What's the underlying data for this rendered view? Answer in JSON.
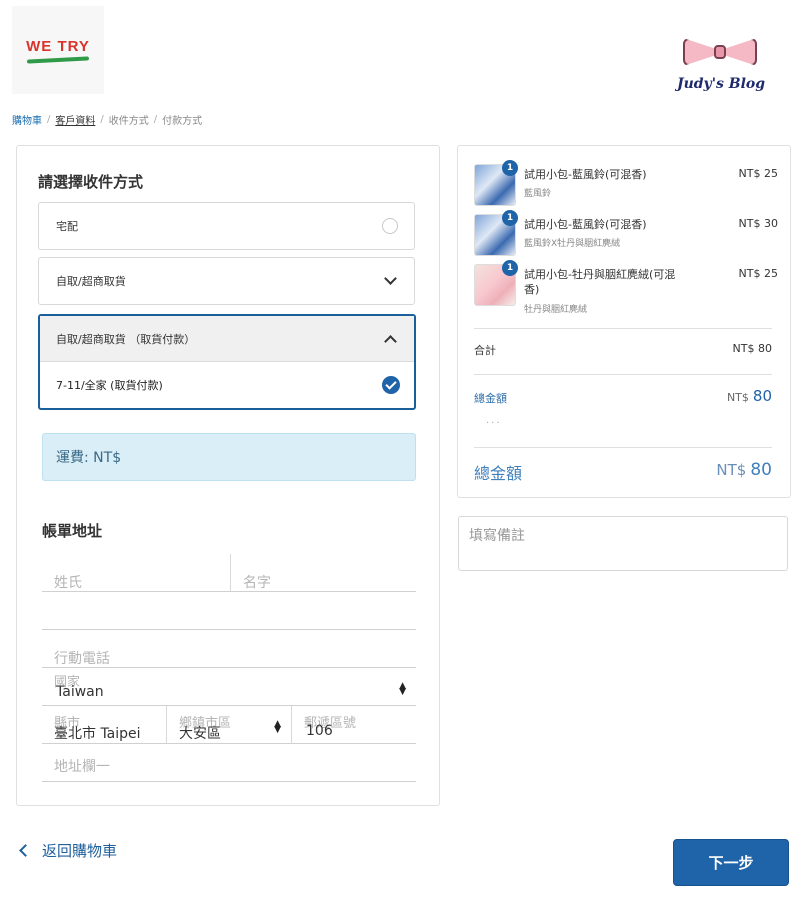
{
  "logo": {
    "text": "WE TRY"
  },
  "watermark": {
    "text": "Judy's Blog"
  },
  "breadcrumb": {
    "items": [
      "購物車",
      "客戶資料",
      "收件方式",
      "付款方式"
    ],
    "separator": "/"
  },
  "delivery": {
    "title": "請選擇收件方式",
    "option_home": "宅配",
    "option_pickup": "自取/超商取貨",
    "option_pickup_cod": "自取/超商取貨 （取貨付款）",
    "selected_sub_option": "7-11/全家 (取貨付款)",
    "shipping_fee": "運費: NT$"
  },
  "billing": {
    "title": "帳單地址",
    "last_name_placeholder": "姓氏",
    "first_name_placeholder": "名字",
    "phone_placeholder": "行動電話",
    "country_label": "國家",
    "country_value": "Taiwan",
    "city_label": "縣市",
    "city_value": "臺北市 Taipei",
    "district_label": "鄉鎮市區",
    "district_value": "大安區",
    "zip_label": "郵遞區號",
    "zip_value": "106",
    "address_placeholder": "地址欄一"
  },
  "cart": {
    "items": [
      {
        "qty": "1",
        "name": "試用小包-藍風鈴(可混香)",
        "variant": "藍風鈴",
        "price": "NT$ 25"
      },
      {
        "qty": "1",
        "name": "試用小包-藍風鈴(可混香)",
        "variant": "藍風鈴X牡丹與胭紅麂絨",
        "price": "NT$ 30"
      },
      {
        "qty": "1",
        "name": "試用小包-牡丹與胭紅麂絨(可混香)",
        "variant": "牡丹與胭紅麂絨",
        "price": "NT$ 25"
      }
    ],
    "subtotal_label": "合計",
    "subtotal_value": "NT$ 80",
    "total_label": "總金額",
    "total_currency": "NT$",
    "total_amount": "80",
    "grand_total_label": "總金額",
    "grand_total_currency": "NT$",
    "grand_total_amount": "80"
  },
  "notes": {
    "placeholder": "填寫備註"
  },
  "footer": {
    "back_label": "返回購物車",
    "next_label": "下一步"
  },
  "colors": {
    "primary": "#1f63a8",
    "link": "#1b6fb0",
    "info_bg": "#d9eef7",
    "logo_red": "#d9342b",
    "logo_green": "#2f9a47"
  }
}
